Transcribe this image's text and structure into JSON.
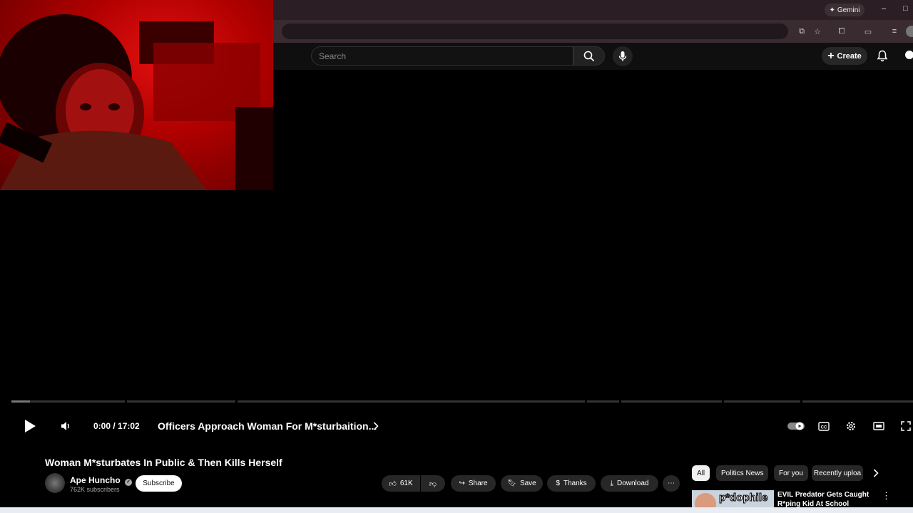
{
  "browser": {
    "gemini_label": "Gemini",
    "window_controls": [
      "–",
      "□"
    ]
  },
  "masthead": {
    "search_placeholder": "Search",
    "create_label": "Create"
  },
  "player": {
    "progress": 0.0,
    "time": "0:00 / 17:02",
    "chapter": "Officers Approach Woman For M*sturbaition...",
    "webcam_overlay": true
  },
  "video": {
    "title": "Woman M*sturbates In Public & Then Kills Herself",
    "channel_name": "Ape Huncho",
    "subscribers": "762K subscribers",
    "subscribe_label": "Subscribe",
    "likes": "61K",
    "share_label": "Share",
    "save_label": "Save",
    "thanks_label": "Thanks",
    "download_label": "Download"
  },
  "chips": [
    "All",
    "Politics News",
    "For you",
    "Recently uploa"
  ],
  "recommended": [
    {
      "thumb_text": "p*dophile",
      "title": "EVIL Predator Gets Caught R*ping Kid At School"
    }
  ],
  "colors": {
    "webcam_red": "#e31010",
    "masthead_bg": "#0f0f0f",
    "pill_bg": "#272727"
  }
}
